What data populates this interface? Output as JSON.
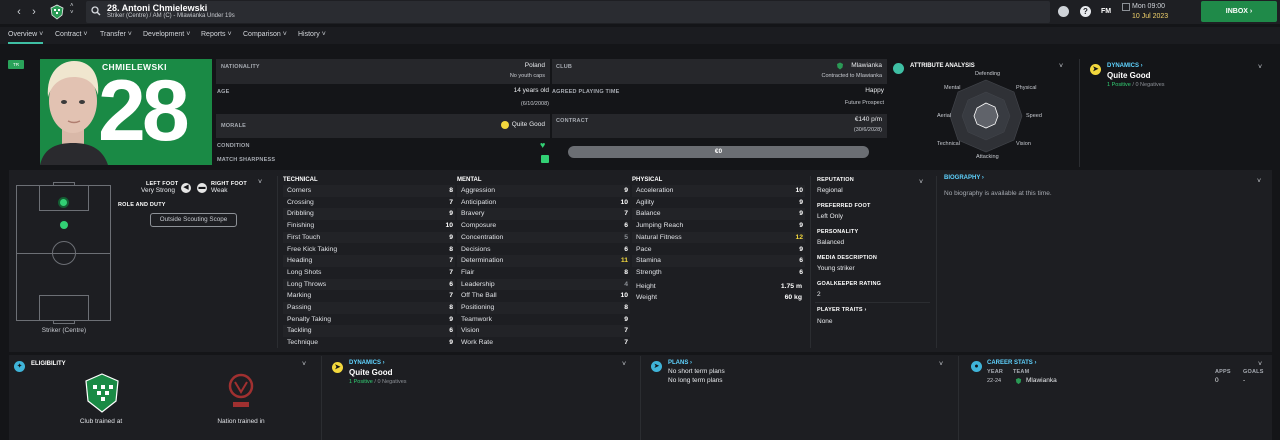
{
  "header": {
    "title": "28. Antoni Chmielewski",
    "subtitle": "Striker (Centre) / AM (C) - Mlawianka Under 19s",
    "date_day": "Mon 09:00",
    "date_full": "10 Jul 2023",
    "fm_label": "FM",
    "inbox_label": "INBOX"
  },
  "tabs": [
    "Overview",
    "Contract",
    "Transfer",
    "Development",
    "Reports",
    "Comparison",
    "History"
  ],
  "profile": {
    "surname": "CHMIELEWSKI",
    "number": "28",
    "badge": "TR"
  },
  "info": {
    "nationality_label": "NATIONALITY",
    "nationality": "Poland",
    "youth_caps": "No youth caps",
    "age_label": "AGE",
    "age": "14 years old",
    "dob": "(6/10/2008)",
    "morale_label": "MORALE",
    "morale": "Quite Good",
    "condition_label": "CONDITION",
    "sharpness_label": "MATCH SHARPNESS",
    "club_label": "CLUB",
    "club": "Mlawianka",
    "club_contract": "Contracted to Mlawianka",
    "playing_time_label": "AGREED PLAYING TIME",
    "happy": "Happy",
    "future": "Future Prospect",
    "contract_label": "CONTRACT",
    "wage": "€140 p/m",
    "contract_end": "(30/6/2028)",
    "value": "€0"
  },
  "attribute_analysis": {
    "title": "ATTRIBUTE ANALYSIS",
    "labels": [
      "Defending",
      "Physical",
      "Speed",
      "Vision",
      "Attacking",
      "Technical",
      "Aerial",
      "Mental"
    ]
  },
  "dynamics_top": {
    "title": "DYNAMICS",
    "value": "Quite Good",
    "positive": "1 Positive",
    "negative": "0 Negatives",
    "sep": "/"
  },
  "feet": {
    "left_label": "LEFT FOOT",
    "left_val": "Very Strong",
    "right_label": "RIGHT FOOT",
    "right_val": "Weak",
    "role_label": "ROLE AND DUTY",
    "scope_btn": "Outside Scouting Scope",
    "position": "Striker (Centre)"
  },
  "technical": {
    "title": "TECHNICAL",
    "items": [
      [
        "Corners",
        "8"
      ],
      [
        "Crossing",
        "7"
      ],
      [
        "Dribbling",
        "9"
      ],
      [
        "Finishing",
        "10"
      ],
      [
        "First Touch",
        "9"
      ],
      [
        "Free Kick Taking",
        "8"
      ],
      [
        "Heading",
        "7"
      ],
      [
        "Long Shots",
        "7"
      ],
      [
        "Long Throws",
        "6"
      ],
      [
        "Marking",
        "7"
      ],
      [
        "Passing",
        "8"
      ],
      [
        "Penalty Taking",
        "9"
      ],
      [
        "Tackling",
        "6"
      ],
      [
        "Technique",
        "9"
      ]
    ]
  },
  "mental": {
    "title": "MENTAL",
    "items": [
      [
        "Aggression",
        "9"
      ],
      [
        "Anticipation",
        "10"
      ],
      [
        "Bravery",
        "7"
      ],
      [
        "Composure",
        "6"
      ],
      [
        "Concentration",
        "5"
      ],
      [
        "Decisions",
        "6"
      ],
      [
        "Determination",
        "11"
      ],
      [
        "Flair",
        "8"
      ],
      [
        "Leadership",
        "4"
      ],
      [
        "Off The Ball",
        "10"
      ],
      [
        "Positioning",
        "8"
      ],
      [
        "Teamwork",
        "9"
      ],
      [
        "Vision",
        "7"
      ],
      [
        "Work Rate",
        "7"
      ]
    ]
  },
  "physical": {
    "title": "PHYSICAL",
    "items": [
      [
        "Acceleration",
        "10"
      ],
      [
        "Agility",
        "9"
      ],
      [
        "Balance",
        "9"
      ],
      [
        "Jumping Reach",
        "9"
      ],
      [
        "Natural Fitness",
        "12"
      ],
      [
        "Pace",
        "9"
      ],
      [
        "Stamina",
        "6"
      ],
      [
        "Strength",
        "6"
      ]
    ],
    "height_label": "Height",
    "height": "1.75 m",
    "weight_label": "Weight",
    "weight": "60 kg"
  },
  "side_info": {
    "reputation_label": "REPUTATION",
    "reputation": "Regional",
    "pref_foot_label": "PREFERRED FOOT",
    "pref_foot": "Left Only",
    "personality_label": "PERSONALITY",
    "personality": "Balanced",
    "media_label": "MEDIA DESCRIPTION",
    "media": "Young striker",
    "gk_label": "GOALKEEPER RATING",
    "gk": "2",
    "traits_label": "PLAYER TRAITS",
    "traits": "None"
  },
  "biography": {
    "title": "BIOGRAPHY",
    "text": "No biography is available at this time."
  },
  "eligibility": {
    "title": "ELIGIBILITY",
    "club_caption": "Club trained at",
    "nation_caption": "Nation trained in"
  },
  "dynamics_bottom": {
    "title": "DYNAMICS",
    "value": "Quite Good",
    "positive": "1 Positive",
    "negative": "0 Negatives",
    "sep": "/"
  },
  "plans": {
    "title": "PLANS",
    "short": "No short term plans",
    "long": "No long term plans"
  },
  "career": {
    "title": "CAREER STATS",
    "year_label": "YEAR",
    "team_label": "TEAM",
    "apps_label": "APPS",
    "goals_label": "GOALS",
    "year": "22-24",
    "team": "Mlawianka",
    "apps": "0",
    "goals": "-"
  },
  "colors": {
    "accent": "#3fbfa4",
    "green": "#32d074",
    "yellow": "#f3d83d",
    "link": "#5fd3ff",
    "club_green": "#1a8a45"
  }
}
